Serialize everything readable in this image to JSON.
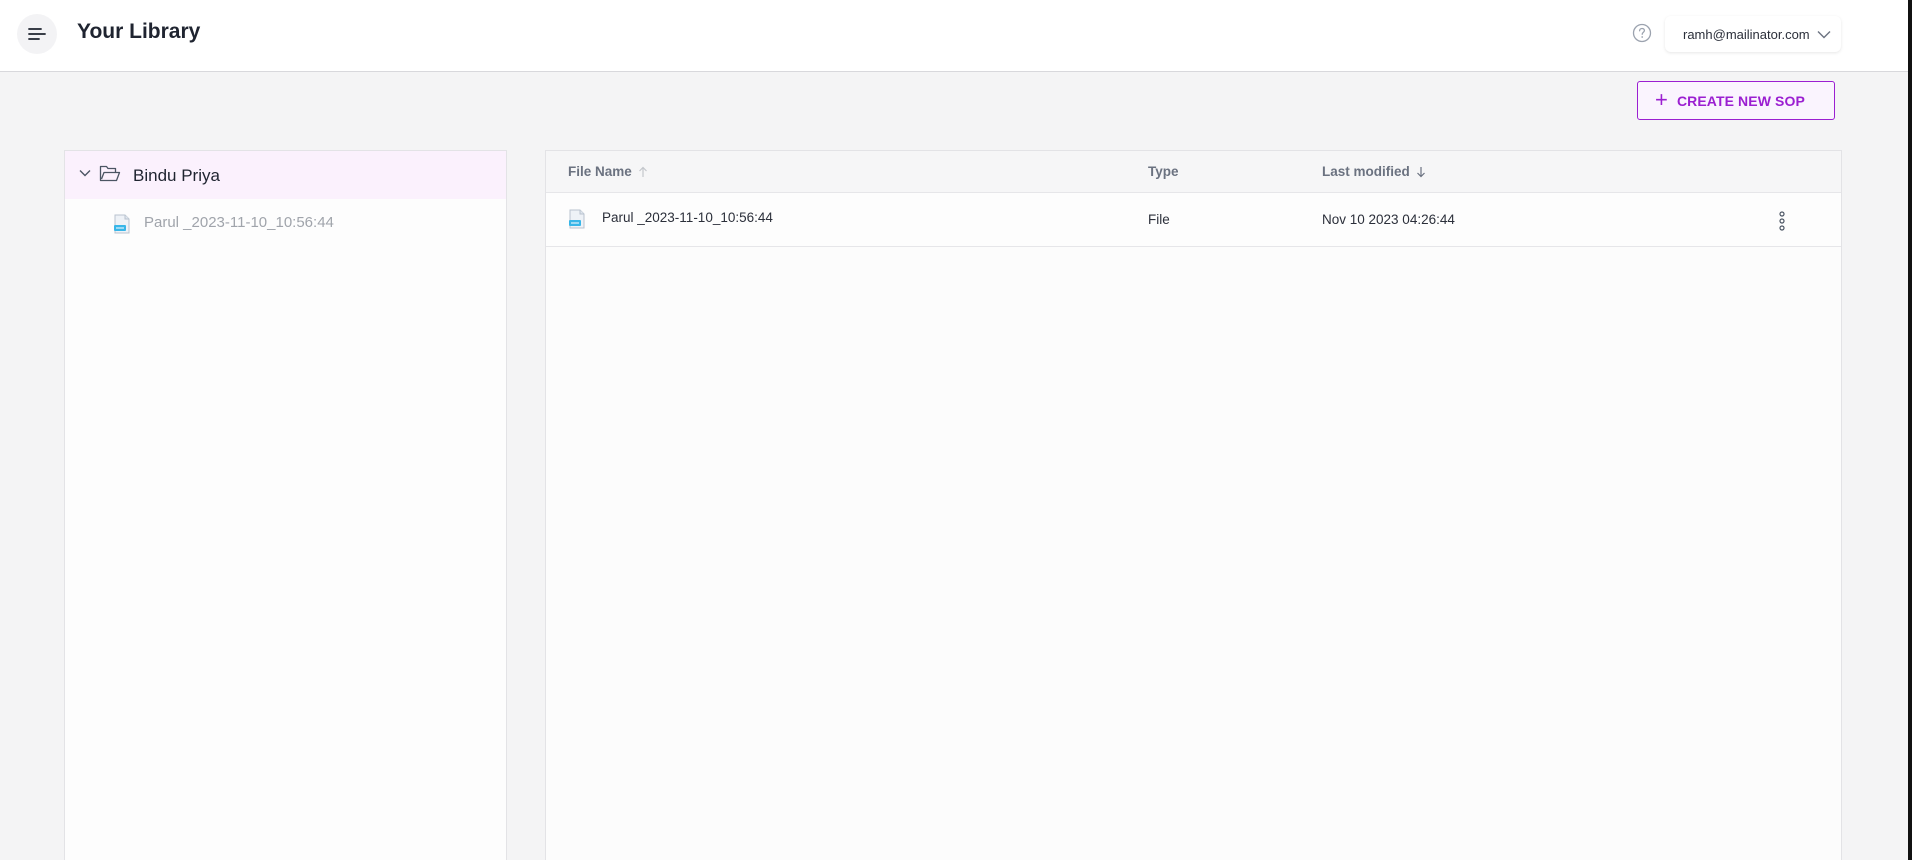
{
  "header": {
    "title": "Your Library",
    "menu_icon": "hamburger-menu-icon",
    "help_icon": "help-circle-icon",
    "user_email": "ramh@mailinator.com"
  },
  "toolbar": {
    "create_label": "CREATE NEW SOP",
    "create_icon": "plus-icon"
  },
  "tree": {
    "folder": {
      "label": "Bindu Priya",
      "expanded": true
    },
    "files": [
      {
        "label": "Parul _2023-11-10_10:56:44"
      }
    ]
  },
  "table": {
    "columns": {
      "name": "File Name",
      "type": "Type",
      "modified": "Last modified"
    },
    "rows": [
      {
        "name": "Parul _2023-11-10_10:56:44",
        "type": "File",
        "modified": "Nov 10 2023 04:26:44"
      }
    ]
  },
  "colors": {
    "accent": "#9b1fd1",
    "accent_bg": "#faf4fe",
    "folder_highlight": "#fbf1fd",
    "background": "#f4f4f5"
  }
}
